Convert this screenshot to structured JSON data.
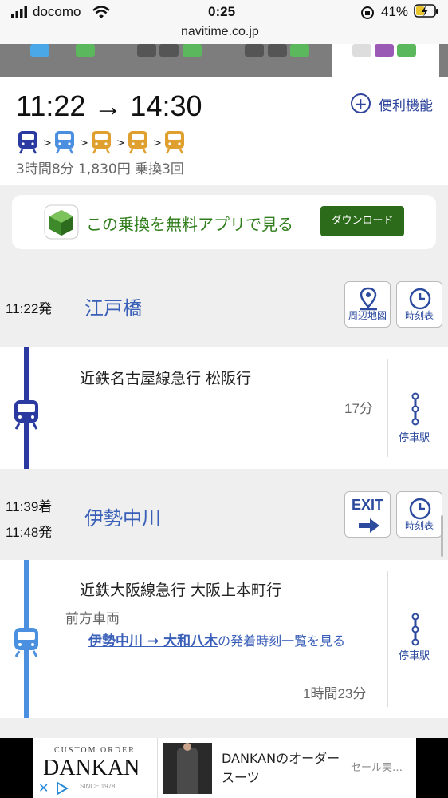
{
  "status_bar": {
    "carrier": "docomo",
    "time": "0:25",
    "battery": "41%",
    "url": "navitime.co.jp"
  },
  "route": {
    "time_range": "11:22 → 14:30",
    "features_label": "便利機能",
    "meta": "3時間8分 1,830円 乗換3回",
    "train_icon_colors": [
      "#2a3aa0",
      "#4a8fe0",
      "#e0a030",
      "#e0a030",
      "#e0a030"
    ]
  },
  "app_banner": {
    "text": "この乗換を無料アプリで見る",
    "download_label": "ダウンロード"
  },
  "stations": [
    {
      "times": [
        "11:22発"
      ],
      "name": "江戸橋",
      "buttons": [
        {
          "label": "周辺地図",
          "icon": "map-pin-icon"
        },
        {
          "label": "時刻表",
          "icon": "clock-icon"
        }
      ]
    },
    {
      "times": [
        "11:39着",
        "11:48発"
      ],
      "name": "伊勢中川",
      "buttons": [
        {
          "label": "EXIT",
          "icon": "exit-arrow-icon"
        },
        {
          "label": "時刻表",
          "icon": "clock-icon"
        }
      ]
    }
  ],
  "segments": [
    {
      "train": "近鉄名古屋線急行 松阪行",
      "duration": "17分",
      "stops_label": "停車駅",
      "line_color": "#2a3aa0"
    },
    {
      "train": "近鉄大阪線急行 大阪上本町行",
      "car_position": "前方車両",
      "link_stations": "伊勢中川 → 大和八木",
      "link_suffix": "の発着時刻一覧を見る",
      "duration": "1時間23分",
      "stops_label": "停車駅",
      "line_color": "#4a8fe0"
    }
  ],
  "ad": {
    "brand_top": "CUSTOM ORDER",
    "brand": "DANKAN",
    "since": "SINCE 1978",
    "headline": "DANKANのオーダースーツ",
    "cta": "セール実…"
  }
}
